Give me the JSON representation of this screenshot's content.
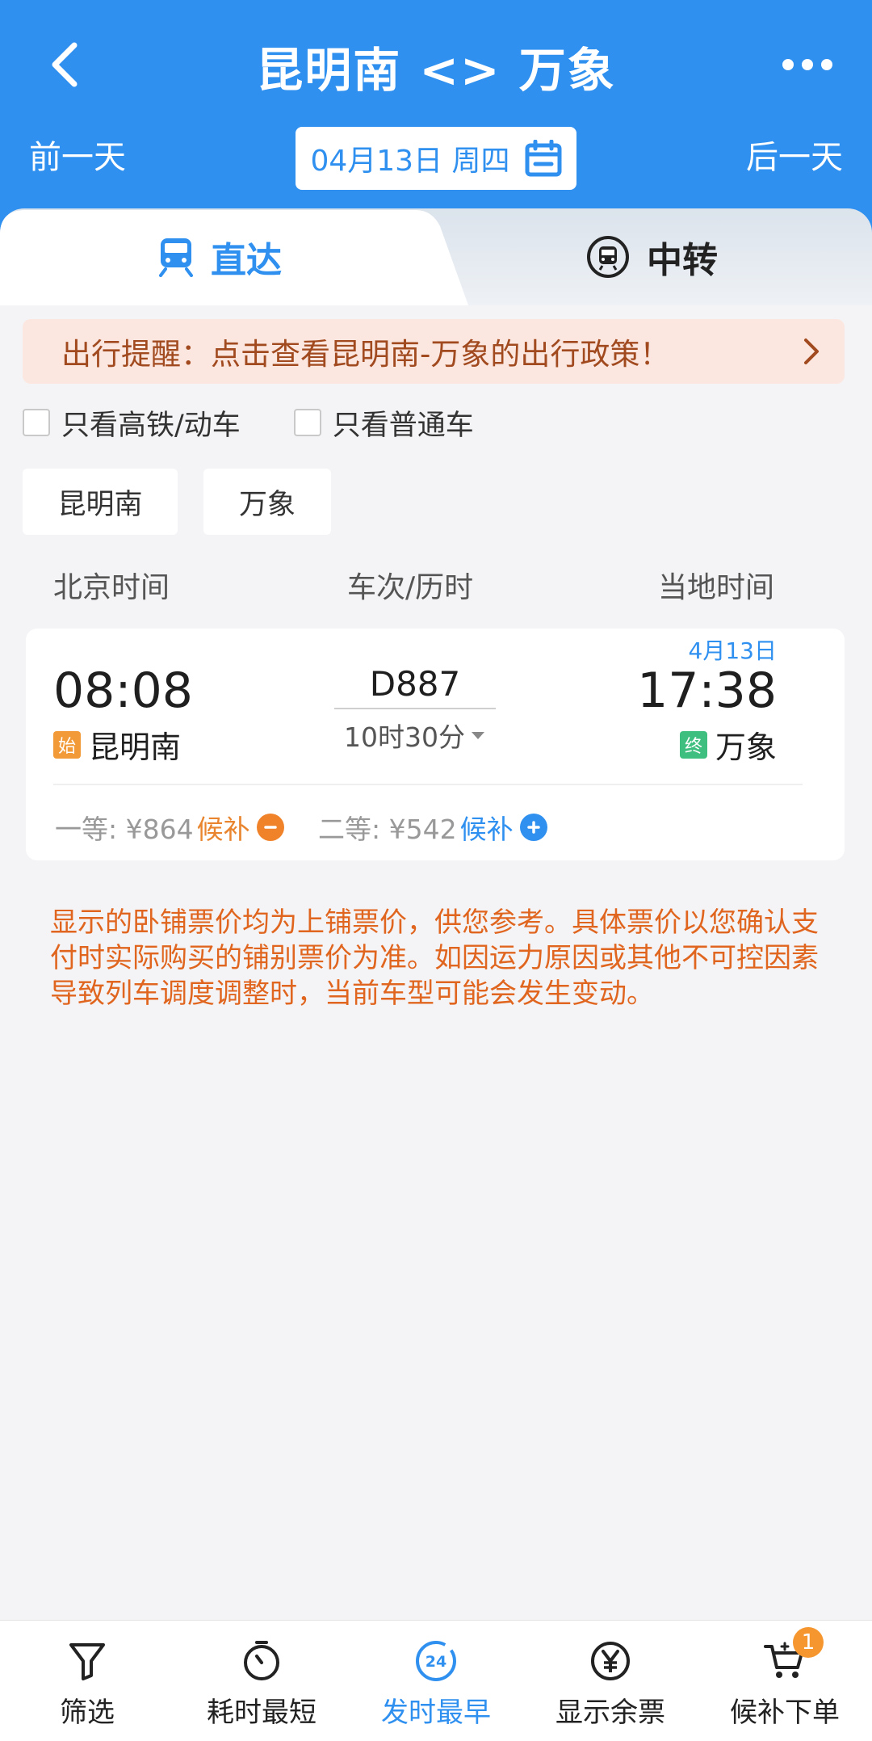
{
  "header": {
    "title": "昆明南 <> 万象",
    "prev_day": "前一天",
    "next_day": "后一天",
    "date": "04月13日 周四",
    "icons": [
      "back-arrow-icon",
      "more-dots-icon",
      "calendar-icon"
    ]
  },
  "tabs": [
    {
      "label": "直达",
      "icon": "train-icon",
      "active": true
    },
    {
      "label": "中转",
      "icon": "transfer-icon",
      "active": false
    }
  ],
  "notice": {
    "text": "出行提醒：点击查看昆明南-万象的出行政策！"
  },
  "filters": {
    "high_speed_label": "只看高铁/动车",
    "normal_label": "只看普通车"
  },
  "stations": {
    "from": "昆明南",
    "to": "万象"
  },
  "columns": {
    "depart": "北京时间",
    "train": "车次/历时",
    "arrive": "当地时间"
  },
  "train": {
    "depart_time": "08:08",
    "depart_tag": "始",
    "depart_station": "昆明南",
    "number": "D887",
    "duration": "10时30分",
    "arrive_date": "4月13日",
    "arrive_time": "17:38",
    "arrive_tag": "终",
    "arrive_station": "万象",
    "seats": [
      {
        "label": "一等: ¥864",
        "status": "候补",
        "status_color": "#e8852e"
      },
      {
        "label": "二等: ¥542",
        "status": "候补",
        "status_color": "#2f90f0"
      }
    ]
  },
  "disclaimer": "显示的卧铺票价均为上铺票价，供您参考。具体票价以您确认支付时实际购买的铺别票价为准。如因运力原因或其他不可控因素导致列车调度调整时，当前车型可能会发生变动。",
  "bottom_bar": [
    {
      "label": "筛选",
      "icon": "filter-icon",
      "active": false
    },
    {
      "label": "耗时最短",
      "icon": "timer-icon",
      "active": false
    },
    {
      "label": "发时最早",
      "icon": "clock-24-icon",
      "icon_text": "24",
      "active": true
    },
    {
      "label": "显示余票",
      "icon": "yen-icon",
      "active": false
    },
    {
      "label": "候补下单",
      "icon": "cart-icon",
      "badge": "1",
      "active": false
    }
  ],
  "colors": {
    "primary": "#2f90f0",
    "warning": "#e0651f",
    "notice_bg": "#fbe7df"
  }
}
